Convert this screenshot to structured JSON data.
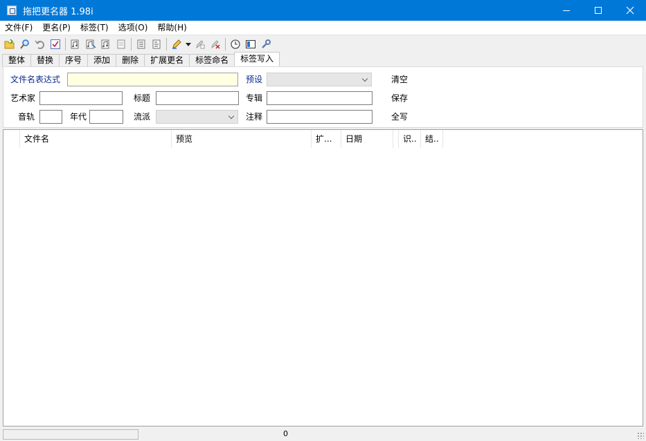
{
  "window": {
    "title": "拖把更名器 1.98i"
  },
  "menu": [
    "文件(F)",
    "更名(P)",
    "标签(T)",
    "选项(O)",
    "帮助(H)"
  ],
  "tabs": [
    {
      "label": "整体"
    },
    {
      "label": "替换"
    },
    {
      "label": "序号"
    },
    {
      "label": "添加"
    },
    {
      "label": "删除"
    },
    {
      "label": "扩展更名"
    },
    {
      "label": "标签命名"
    },
    {
      "label": "标签写入",
      "active": true
    }
  ],
  "form": {
    "filename_expr_label": "文件名表达式",
    "filename_expr_value": "",
    "preset_label": "预设",
    "preset_value": "",
    "clear_label": "清空",
    "artist_label": "艺术家",
    "artist_value": "",
    "title_label": "标题",
    "title_value": "",
    "album_label": "专辑",
    "album_value": "",
    "save_label": "保存",
    "track_label": "音轨",
    "track_value": "",
    "year_label": "年代",
    "year_value": "",
    "genre_label": "流派",
    "genre_value": "",
    "comment_label": "注释",
    "comment_value": "",
    "write_all_label": "全写"
  },
  "columns": [
    "",
    "文件名",
    "预览",
    "扩...",
    "日期",
    "",
    "识..",
    "结.."
  ],
  "status": {
    "count": "0"
  },
  "colors": {
    "titlebar": "#0078d7",
    "highlight_field": "#ffffe1",
    "label_blue": "#0b2c8a"
  }
}
